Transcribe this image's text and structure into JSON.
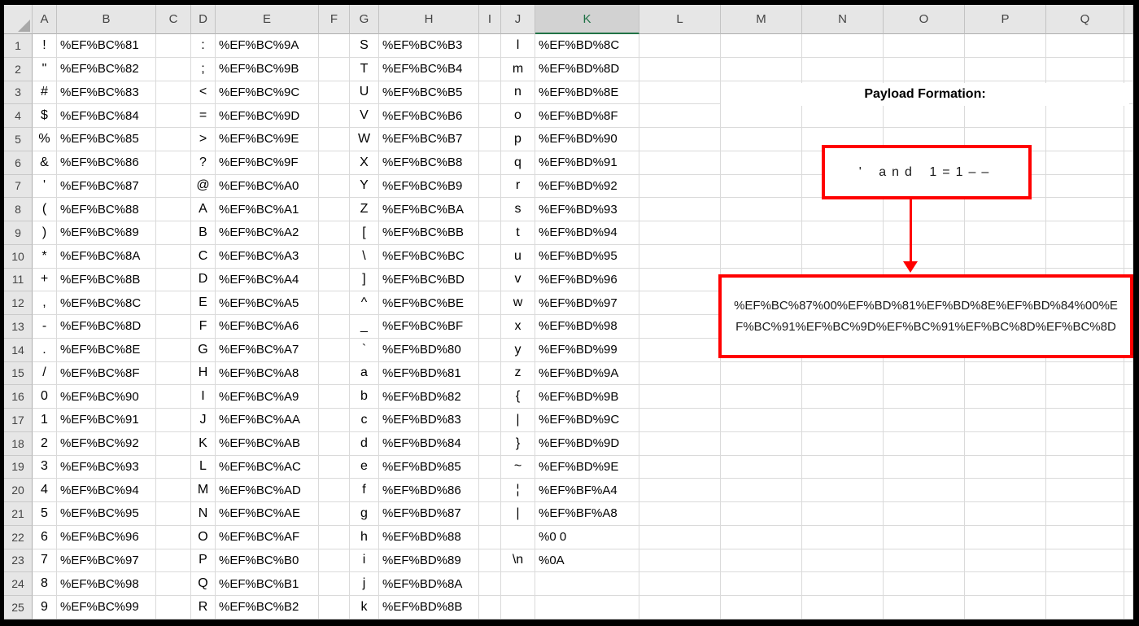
{
  "sheet": {
    "selected_column": "K",
    "column_labels": [
      "A",
      "B",
      "C",
      "D",
      "E",
      "F",
      "G",
      "H",
      "I",
      "J",
      "K",
      "L",
      "M",
      "N",
      "O",
      "P",
      "Q",
      ""
    ],
    "row_labels": [
      "1",
      "2",
      "3",
      "4",
      "5",
      "6",
      "7",
      "8",
      "9",
      "10",
      "11",
      "12",
      "13",
      "14",
      "15",
      "16",
      "17",
      "18",
      "19",
      "20",
      "21",
      "22",
      "23",
      "24",
      "25"
    ],
    "rows": [
      {
        "a": "!",
        "b": "%EF%BC%81",
        "d": ":",
        "e": "%EF%BC%9A",
        "g": "S",
        "h": "%EF%BC%B3",
        "j": "l",
        "k": "%EF%BD%8C"
      },
      {
        "a": "\"",
        "b": "%EF%BC%82",
        "d": ";",
        "e": "%EF%BC%9B",
        "g": "T",
        "h": "%EF%BC%B4",
        "j": "m",
        "k": "%EF%BD%8D"
      },
      {
        "a": "#",
        "b": "%EF%BC%83",
        "d": "<",
        "e": "%EF%BC%9C",
        "g": "U",
        "h": "%EF%BC%B5",
        "j": "n",
        "k": "%EF%BD%8E"
      },
      {
        "a": "$",
        "b": "%EF%BC%84",
        "d": "=",
        "e": "%EF%BC%9D",
        "g": "V",
        "h": "%EF%BC%B6",
        "j": "o",
        "k": "%EF%BD%8F"
      },
      {
        "a": "%",
        "b": "%EF%BC%85",
        "d": ">",
        "e": "%EF%BC%9E",
        "g": "W",
        "h": "%EF%BC%B7",
        "j": "p",
        "k": "%EF%BD%90"
      },
      {
        "a": "&",
        "b": "%EF%BC%86",
        "d": "?",
        "e": "%EF%BC%9F",
        "g": "X",
        "h": "%EF%BC%B8",
        "j": "q",
        "k": "%EF%BD%91"
      },
      {
        "a": "'",
        "b": "%EF%BC%87",
        "d": "@",
        "e": "%EF%BC%A0",
        "g": "Y",
        "h": "%EF%BC%B9",
        "j": "r",
        "k": "%EF%BD%92"
      },
      {
        "a": "(",
        "b": "%EF%BC%88",
        "d": "A",
        "e": "%EF%BC%A1",
        "g": "Z",
        "h": "%EF%BC%BA",
        "j": "s",
        "k": "%EF%BD%93"
      },
      {
        "a": ")",
        "b": "%EF%BC%89",
        "d": "B",
        "e": "%EF%BC%A2",
        "g": "[",
        "h": "%EF%BC%BB",
        "j": "t",
        "k": "%EF%BD%94"
      },
      {
        "a": "*",
        "b": "%EF%BC%8A",
        "d": "C",
        "e": "%EF%BC%A3",
        "g": "\\",
        "h": "%EF%BC%BC",
        "j": "u",
        "k": "%EF%BD%95"
      },
      {
        "a": "+",
        "b": "%EF%BC%8B",
        "d": "D",
        "e": "%EF%BC%A4",
        "g": "]",
        "h": "%EF%BC%BD",
        "j": "v",
        "k": "%EF%BD%96"
      },
      {
        "a": ",",
        "b": "%EF%BC%8C",
        "d": "E",
        "e": "%EF%BC%A5",
        "g": "^",
        "h": "%EF%BC%BE",
        "j": "w",
        "k": "%EF%BD%97"
      },
      {
        "a": "-",
        "b": "%EF%BC%8D",
        "d": "F",
        "e": "%EF%BC%A6",
        "g": "_",
        "h": "%EF%BC%BF",
        "j": "x",
        "k": "%EF%BD%98"
      },
      {
        "a": ".",
        "b": "%EF%BC%8E",
        "d": "G",
        "e": "%EF%BC%A7",
        "g": "`",
        "h": "%EF%BD%80",
        "j": "y",
        "k": "%EF%BD%99"
      },
      {
        "a": "/",
        "b": "%EF%BC%8F",
        "d": "H",
        "e": "%EF%BC%A8",
        "g": "a",
        "h": "%EF%BD%81",
        "j": "z",
        "k": "%EF%BD%9A"
      },
      {
        "a": "0",
        "b": "%EF%BC%90",
        "d": "I",
        "e": "%EF%BC%A9",
        "g": "b",
        "h": "%EF%BD%82",
        "j": "{",
        "k": "%EF%BD%9B"
      },
      {
        "a": "1",
        "b": "%EF%BC%91",
        "d": "J",
        "e": "%EF%BC%AA",
        "g": "c",
        "h": "%EF%BD%83",
        "j": "|",
        "k": "%EF%BD%9C"
      },
      {
        "a": "2",
        "b": "%EF%BC%92",
        "d": "K",
        "e": "%EF%BC%AB",
        "g": "d",
        "h": "%EF%BD%84",
        "j": "}",
        "k": "%EF%BD%9D"
      },
      {
        "a": "3",
        "b": "%EF%BC%93",
        "d": "L",
        "e": "%EF%BC%AC",
        "g": "e",
        "h": "%EF%BD%85",
        "j": "~",
        "k": "%EF%BD%9E"
      },
      {
        "a": "4",
        "b": "%EF%BC%94",
        "d": "M",
        "e": "%EF%BC%AD",
        "g": "f",
        "h": "%EF%BD%86",
        "j": "¦",
        "k": "%EF%BF%A4"
      },
      {
        "a": "5",
        "b": "%EF%BC%95",
        "d": "N",
        "e": "%EF%BC%AE",
        "g": "g",
        "h": "%EF%BD%87",
        "j": "|",
        "k": "%EF%BF%A8"
      },
      {
        "a": "6",
        "b": "%EF%BC%96",
        "d": "O",
        "e": "%EF%BC%AF",
        "g": "h",
        "h": "%EF%BD%88",
        "j": "",
        "k": "%0 0"
      },
      {
        "a": "7",
        "b": "%EF%BC%97",
        "d": "P",
        "e": "%EF%BC%B0",
        "g": "i",
        "h": "%EF%BD%89",
        "j": "\\n",
        "k": "%0A"
      },
      {
        "a": "8",
        "b": "%EF%BC%98",
        "d": "Q",
        "e": "%EF%BC%B1",
        "g": "j",
        "h": "%EF%BD%8A",
        "j": "",
        "k": ""
      },
      {
        "a": "9",
        "b": "%EF%BC%99",
        "d": "R",
        "e": "%EF%BC%B2",
        "g": "k",
        "h": "%EF%BD%8B",
        "j": "",
        "k": ""
      }
    ]
  },
  "annotation": {
    "title": "Payload Formation:",
    "payload_plain": "' and 1=1––",
    "payload_encoded": "%EF%BC%87%00%EF%BD%81%EF%BD%8E%EF%BD%84%00%EF%BC%91%EF%BC%9D%EF%BC%91%EF%BC%8D%EF%BC%8D",
    "accent_red": "#ff0000",
    "selection_green": "#217346"
  }
}
